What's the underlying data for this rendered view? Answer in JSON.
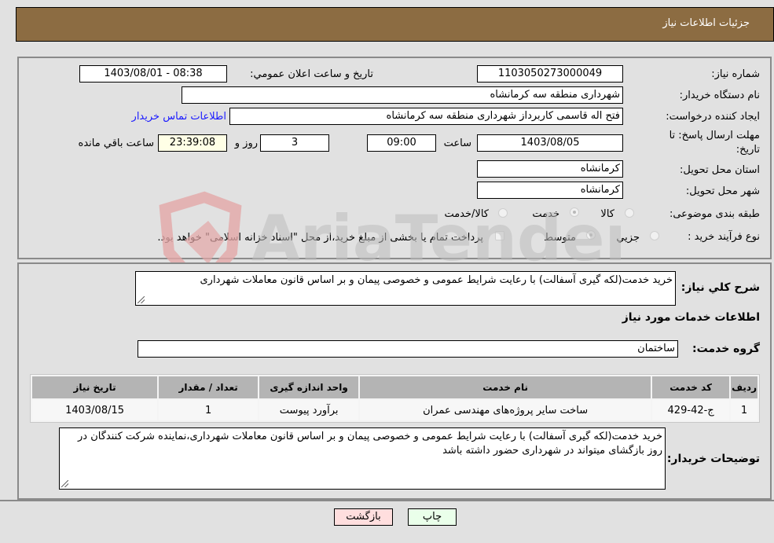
{
  "header": {
    "title": "جزئیات اطلاعات نیاز"
  },
  "fields": {
    "need_number_label": "شماره نیاز:",
    "need_number": "1103050273000049",
    "announce_label": "تاریخ و ساعت اعلان عمومي:",
    "announce_value": "1403/08/01 - 08:38",
    "buyer_org_label": "نام دستگاه خریدار:",
    "buyer_org": "شهرداری منطقه سه کرمانشاه",
    "creator_label": "ایجاد کننده درخواست:",
    "creator": "فتح اله قاسمی کاربرداز شهرداری منطقه سه کرمانشاه",
    "contact_link": "اطلاعات تماس خریدار",
    "deadline_label_1": "مهلت ارسال پاسخ: تا",
    "deadline_label_2": "تاریخ:",
    "deadline_date": "1403/08/05",
    "time_label": "ساعت",
    "deadline_time": "09:00",
    "days_value": "3",
    "days_label": "روز و",
    "remaining_time": "23:39:08",
    "remaining_label": "ساعت باقي مانده",
    "province_label": "استان محل تحویل:",
    "province": "کرمانشاه",
    "city_label": "شهر محل تحویل:",
    "city": "کرمانشاه",
    "category_label": "طبقه بندی موضوعی:",
    "category_options": [
      "کالا",
      "خدمت",
      "کالا/خدمت"
    ],
    "category_selected": "خدمت",
    "process_label": "نوع فرآیند خرید :",
    "process_options": [
      "جزیي",
      "متوسط"
    ],
    "process_selected": "متوسط",
    "treasury_note": "پرداخت تمام یا بخشی از مبلغ خرید،از محل \"اسناد خزانه اسلامی\" خواهد بود."
  },
  "details": {
    "summary_label": "شرح کلي نیاز:",
    "summary": "خرید خدمت(لکه گیری آسفالت) با رعایت شرایط عمومی و خصوصی پیمان و بر اساس قانون معاملات شهرداری",
    "services_heading": "اطلاعات خدمات مورد نیاز",
    "service_group_label": "گروه خدمت:",
    "service_group": "ساختمان"
  },
  "table": {
    "headers": [
      "ردیف",
      "کد خدمت",
      "نام خدمت",
      "واحد اندازه گیری",
      "تعداد / مقدار",
      "تاریخ نیاز"
    ],
    "rows": [
      [
        "1",
        "ج-42-429",
        "ساخت سایر پروژه‌های مهندسی عمران",
        "برآورد پیوست",
        "1",
        "1403/08/15"
      ]
    ]
  },
  "buyer_notes": {
    "label": "توضیحات خریدار:",
    "text": "خرید خدمت(لکه گیری آسفالت) با رعایت شرایط عمومی و خصوصی پیمان و بر اساس قانون معاملات شهرداری،نماینده شرکت کنندگان در روز بازگشای میتواند در شهرداری حضور داشته باشد"
  },
  "buttons": {
    "print": "چاپ",
    "back": "بازگشت"
  },
  "watermark": {
    "text": "AriaTender.neT"
  },
  "colors": {
    "header_bg": "#8c6c42",
    "print_bg": "#eaffea",
    "back_bg": "#ffdede",
    "link": "#1a1aff"
  }
}
